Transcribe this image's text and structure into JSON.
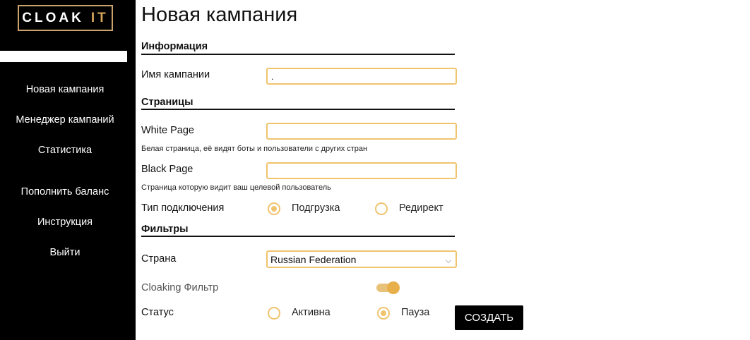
{
  "sidebar": {
    "logo": {
      "text": "CLOAK",
      "accent": "IT"
    },
    "items": [
      {
        "label": "Новая кампания"
      },
      {
        "label": "Менеджер кампаний"
      },
      {
        "label": "Статистика"
      },
      {
        "label": "Пополнить баланс"
      },
      {
        "label": "Инструкция"
      },
      {
        "label": "Выйти"
      }
    ]
  },
  "page": {
    "title": "Новая кампания"
  },
  "sections": {
    "info": "Информация",
    "pages": "Страницы",
    "filters": "Фильтры"
  },
  "fields": {
    "campaign_name": {
      "label": "Имя кампании",
      "value": "."
    },
    "white_page": {
      "label": "White Page",
      "value": "",
      "hint": "Белая страница, её видят боты и пользователи с других стран"
    },
    "black_page": {
      "label": "Black Page",
      "value": "",
      "hint": "Страница которую видит ваш целевой пользователь"
    },
    "connection_type": {
      "label": "Тип подключения",
      "options": [
        "Подгрузка",
        "Редирект"
      ],
      "selected": "Подгрузка"
    },
    "country": {
      "label": "Страна",
      "value": "Russian Federation"
    },
    "cloaking_filter": {
      "label": "Cloaking Фильтр",
      "enabled": true
    },
    "status": {
      "label": "Статус",
      "options": [
        "Активна",
        "Пауза"
      ],
      "selected": "Пауза"
    }
  },
  "actions": {
    "create_label": "СОЗДАТЬ"
  },
  "colors": {
    "accent": "#f0c36e",
    "sidebar_bg": "#000000",
    "logo_border": "#c9a36a"
  },
  "icons": {
    "select_chevron": "chevron-down-icon"
  }
}
